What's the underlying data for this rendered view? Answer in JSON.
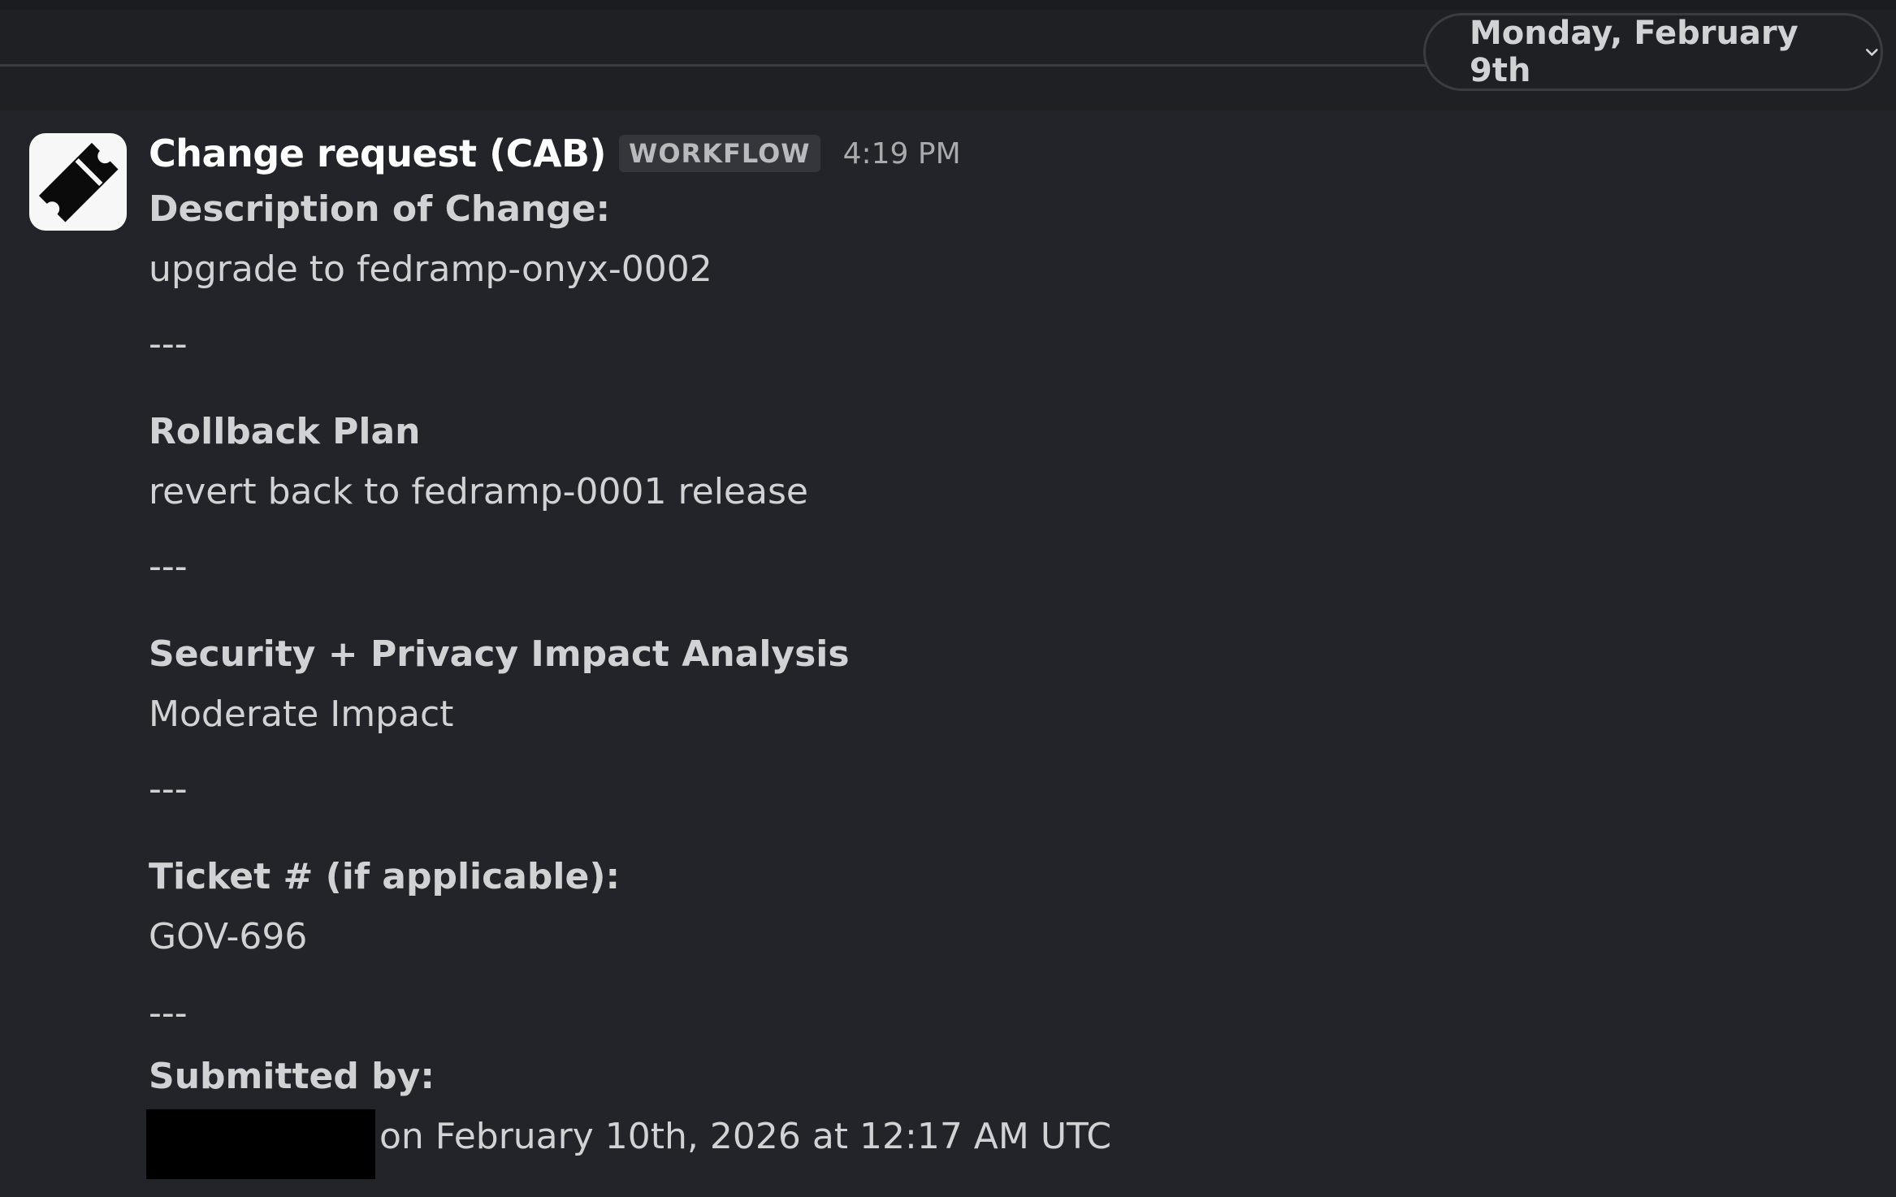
{
  "date_divider": {
    "label": "Monday, February 9th",
    "chevron_icon": "chevron-down-icon"
  },
  "message": {
    "avatar_icon": "ticket-icon",
    "sender": "Change request (CAB)",
    "badge": "WORKFLOW",
    "time": "4:19 PM",
    "sections": [
      {
        "label": "Description of Change:",
        "value": "upgrade to fedramp-onyx-0002"
      },
      {
        "label": "Rollback Plan",
        "value": "revert back to fedramp-0001 release"
      },
      {
        "label": "Security + Privacy Impact Analysis",
        "value": "Moderate Impact"
      },
      {
        "label": "Ticket # (if applicable):",
        "value": "GOV-696"
      }
    ],
    "separator": "---",
    "submitted_label": "Submitted by:",
    "submitted_value": "on February 10th, 2026 at 12:17 AM UTC"
  },
  "colors": {
    "background": "#222429",
    "text": "#d1d2d3",
    "sender": "#ffffff"
  }
}
